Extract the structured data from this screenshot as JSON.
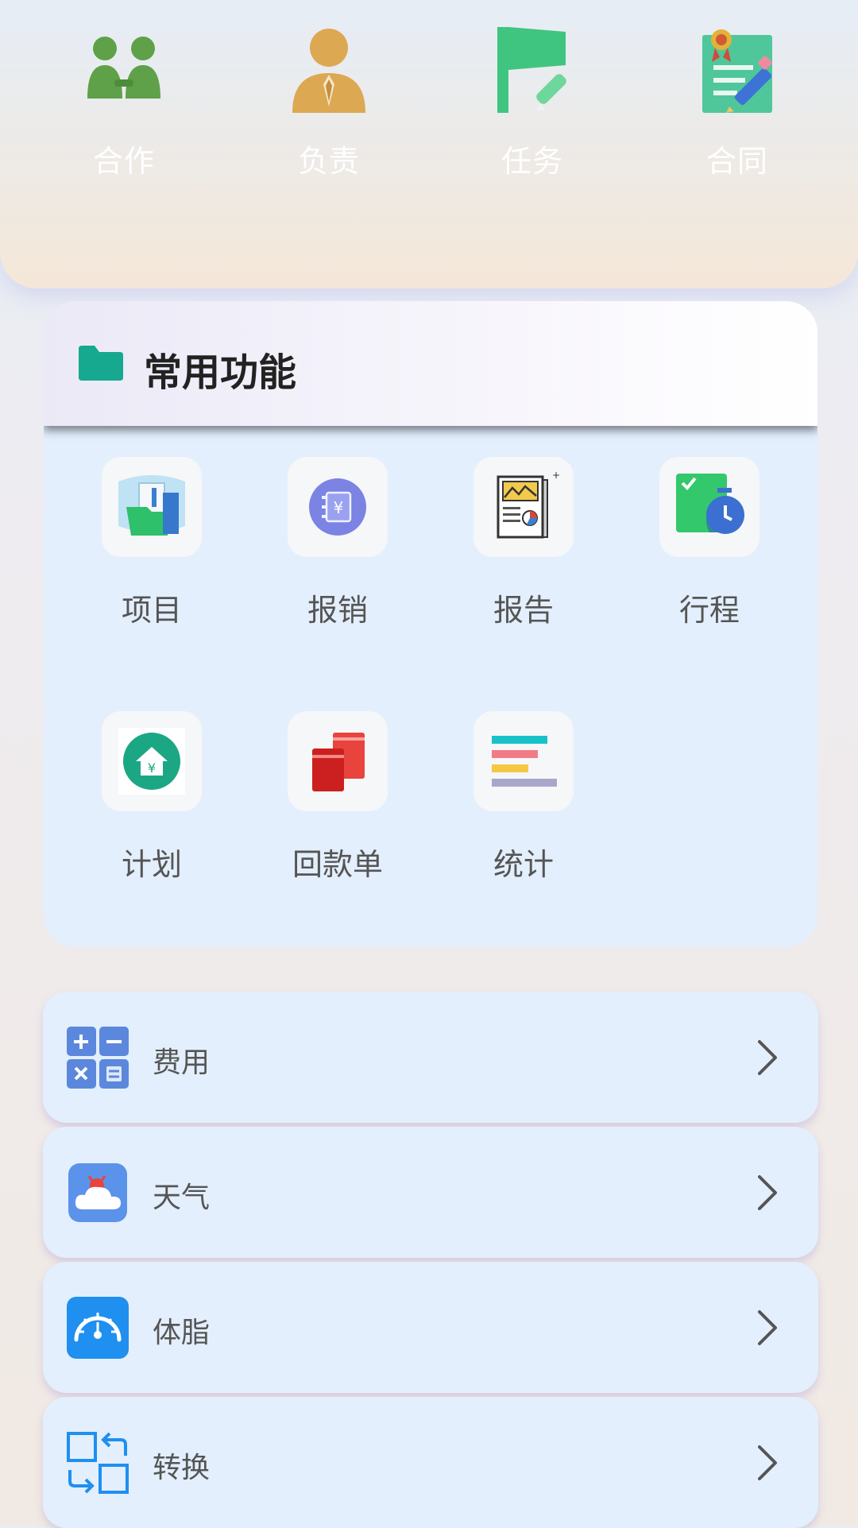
{
  "top_nav": [
    {
      "label": "合作",
      "icon": "handshake-people-icon"
    },
    {
      "label": "负责",
      "icon": "manager-person-icon"
    },
    {
      "label": "任务",
      "icon": "task-flag-icon"
    },
    {
      "label": "合同",
      "icon": "contract-certificate-icon"
    }
  ],
  "functions": {
    "title": "常用功能",
    "items": [
      {
        "label": "项目",
        "icon": "project-folder-icon"
      },
      {
        "label": "报销",
        "icon": "reimburse-coin-icon"
      },
      {
        "label": "报告",
        "icon": "report-document-icon"
      },
      {
        "label": "行程",
        "icon": "schedule-clock-icon"
      },
      {
        "label": "计划",
        "icon": "plan-house-icon"
      },
      {
        "label": "回款单",
        "icon": "payment-receipt-icon"
      },
      {
        "label": "统计",
        "icon": "statistics-bars-icon"
      }
    ]
  },
  "list": [
    {
      "label": "费用",
      "icon": "calculator-icon"
    },
    {
      "label": "天气",
      "icon": "weather-cloud-icon"
    },
    {
      "label": "体脂",
      "icon": "body-fat-scale-icon"
    },
    {
      "label": "转换",
      "icon": "convert-arrows-icon"
    }
  ],
  "colors": {
    "accent_teal": "#17a98f",
    "card_background": "#e3effc",
    "label_gray": "#555555",
    "title_dark": "#222222"
  }
}
